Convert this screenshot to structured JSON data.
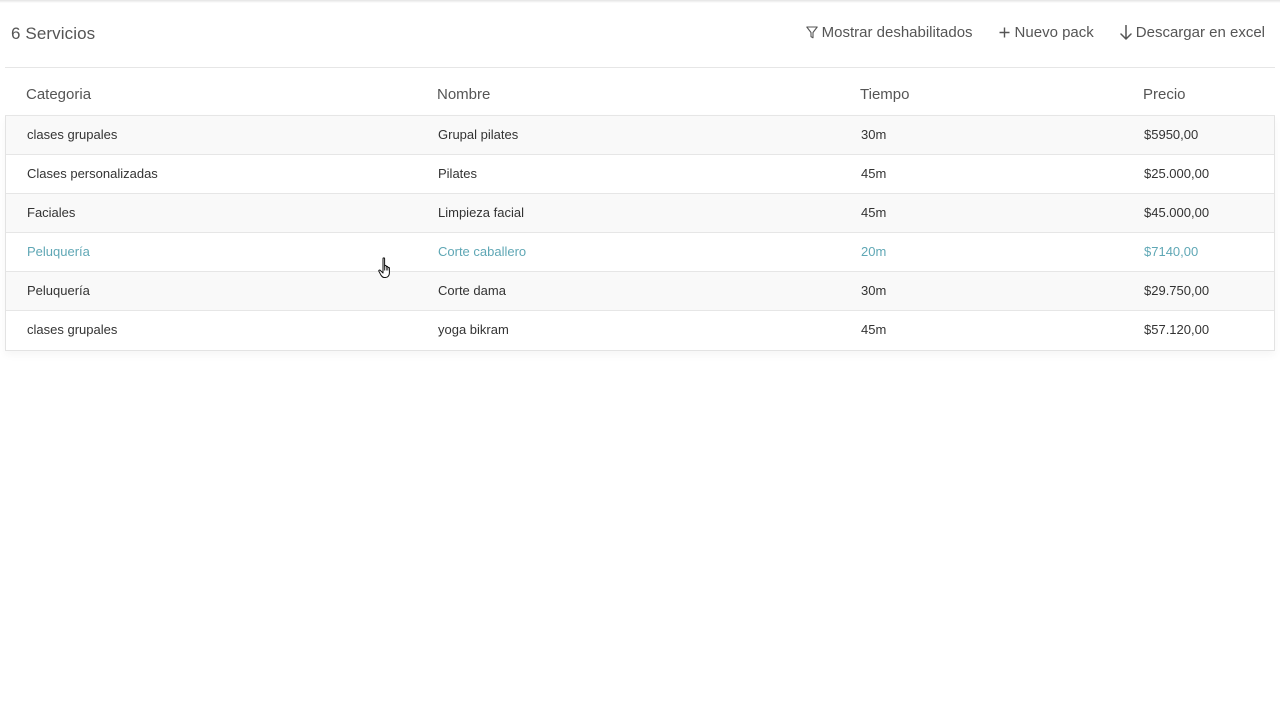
{
  "header": {
    "count_title": "6 Servicios",
    "actions": [
      {
        "label": "Mostrar deshabilitados",
        "icon": "filter-icon"
      },
      {
        "label": "Nuevo pack",
        "icon": "plus-icon"
      },
      {
        "label": "Descargar en excel",
        "icon": "arrow-down-icon"
      }
    ]
  },
  "table": {
    "columns": [
      "Categoria",
      "Nombre",
      "Tiempo",
      "Precio"
    ],
    "rows": [
      {
        "categoria": "clases grupales",
        "nombre": "Grupal pilates",
        "tiempo": "30m",
        "precio": "$5950,00"
      },
      {
        "categoria": "Clases personalizadas",
        "nombre": "Pilates",
        "tiempo": "45m",
        "precio": "$25.000,00"
      },
      {
        "categoria": "Faciales",
        "nombre": "Limpieza facial",
        "tiempo": "45m",
        "precio": "$45.000,00"
      },
      {
        "categoria": "Peluquería",
        "nombre": "Corte caballero",
        "tiempo": "20m",
        "precio": "$7140,00"
      },
      {
        "categoria": "Peluquería",
        "nombre": "Corte dama",
        "tiempo": "30m",
        "precio": "$29.750,00"
      },
      {
        "categoria": "clases grupales",
        "nombre": "yoga bikram",
        "tiempo": "45m",
        "precio": "$57.120,00"
      }
    ],
    "hovered_row_index": 3
  },
  "colors": {
    "accent": "#5fa7b5",
    "text": "#333333",
    "muted_text": "#555555",
    "border": "#e6e6e6"
  }
}
